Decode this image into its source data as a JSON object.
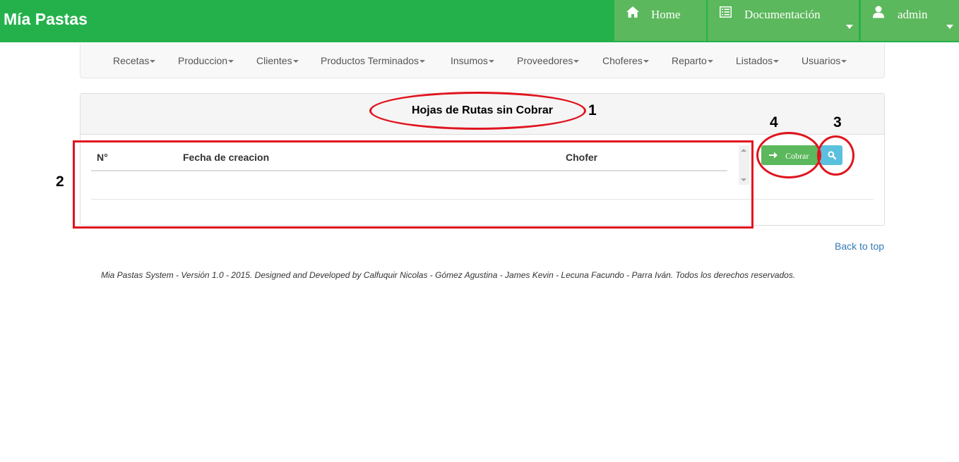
{
  "app": {
    "brand": "Mía Pastas"
  },
  "topnav": {
    "home": {
      "label": "Home",
      "icon": "home-icon"
    },
    "docs": {
      "label": "Documentación",
      "icon": "list-icon"
    },
    "user": {
      "label": "admin",
      "icon": "user-icon"
    }
  },
  "menu": {
    "items": [
      {
        "label": "Recetas"
      },
      {
        "label": "Produccion"
      },
      {
        "label": "Clientes"
      },
      {
        "label": "Productos Terminados"
      },
      {
        "label": "Insumos"
      },
      {
        "label": "Proveedores"
      },
      {
        "label": "Choferes"
      },
      {
        "label": "Reparto"
      },
      {
        "label": "Listados"
      },
      {
        "label": "Usuarios"
      }
    ]
  },
  "panel": {
    "title": "Hojas de Rutas sin Cobrar",
    "table": {
      "columns": [
        "N°",
        "Fecha de creacion",
        "Chofer"
      ],
      "rows": []
    },
    "actions": {
      "cobrar_label": "Cobrar",
      "search_icon": "search-icon"
    }
  },
  "annotations": {
    "n1": "1",
    "n2": "2",
    "n3": "3",
    "n4": "4"
  },
  "links": {
    "back_to_top": "Back to top"
  },
  "footer": {
    "text": "Mia Pastas System - Versión 1.0 - 2015. Designed and Developed by Calfuquir Nicolas - Gómez Agustina - James Kevin - Lecuna Facundo - Parra Iván. Todos los derechos reservados."
  },
  "colors": {
    "header_green": "#24b14c",
    "button_green": "#5cb85c",
    "info_blue": "#5bc0de",
    "annotation_red": "#e0141e",
    "link_blue": "#337ab7"
  }
}
